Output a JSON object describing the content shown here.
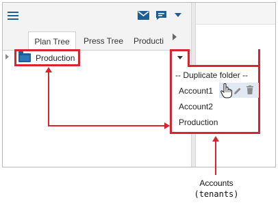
{
  "colors": {
    "accent": "#1f5d95",
    "highlight": "#d9232e",
    "selected_row": "#dfe8f3"
  },
  "header": {
    "icons": [
      "menu-icon",
      "mail-icon",
      "chat-icon",
      "chevron-down-icon"
    ]
  },
  "tabs": [
    {
      "label": "Plan Tree",
      "active": true
    },
    {
      "label": "Press Tree",
      "active": false
    },
    {
      "label": "Producti",
      "active": false
    }
  ],
  "tree": {
    "root_node": {
      "label": "Production",
      "icon": "folder-icon"
    }
  },
  "menu": {
    "header": "-- Duplicate folder --",
    "items": [
      {
        "label": "Account1"
      },
      {
        "label": "Account2"
      },
      {
        "label": "Production"
      }
    ],
    "row_actions": [
      "edit-icon",
      "delete-icon"
    ]
  },
  "callout": {
    "line1": "Accounts",
    "line2": "(tenants)"
  }
}
